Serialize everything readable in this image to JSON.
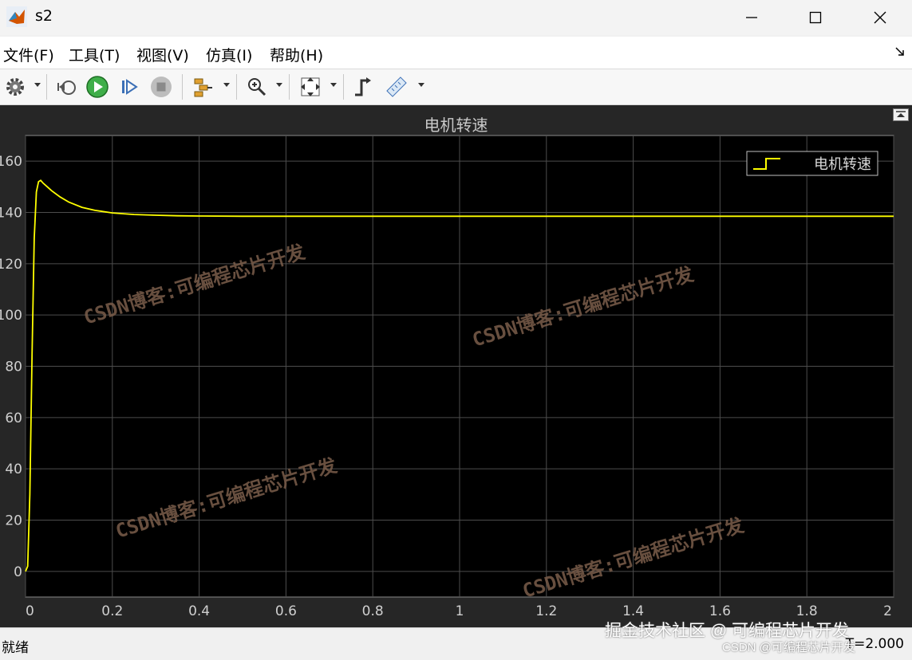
{
  "window": {
    "title": "s2"
  },
  "menu": [
    {
      "label": "文件(F)"
    },
    {
      "label": "工具(T)"
    },
    {
      "label": "视图(V)"
    },
    {
      "label": "仿真(I)"
    },
    {
      "label": "帮助(H)"
    }
  ],
  "toolbar": {
    "icons": [
      "settings-icon",
      "step-back-icon",
      "run-icon",
      "step-forward-icon",
      "stop-icon",
      "signal-selector-icon",
      "zoom-icon",
      "autoscale-icon",
      "triggers-icon",
      "measurements-icon"
    ]
  },
  "colors": {
    "plot_bg": "#000000",
    "frame_bg": "#262626",
    "trace": "#ffff00",
    "grid": "#4d4d4d",
    "axis_text": "#cfcfcf"
  },
  "chart_data": {
    "type": "line",
    "title": "电机转速",
    "xlim": [
      0,
      2
    ],
    "ylim": [
      -10,
      170
    ],
    "x_ticks": [
      0,
      0.2,
      0.4,
      0.6,
      0.8,
      1,
      1.2,
      1.4,
      1.6,
      1.8,
      2
    ],
    "x_tick_labels": [
      "0",
      "0.2",
      "0.4",
      "0.6",
      "0.8",
      "1",
      "1.2",
      "1.4",
      "1.6",
      "1.8",
      "2"
    ],
    "y_ticks": [
      0,
      20,
      40,
      60,
      80,
      100,
      120,
      140,
      160
    ],
    "y_tick_labels": [
      "0",
      "20",
      "40",
      "60",
      "80",
      "100",
      "120",
      "140",
      "160"
    ],
    "grid": true,
    "legend_position": "top-right",
    "series": [
      {
        "name": "电机转速",
        "x": [
          0,
          0.005,
          0.01,
          0.015,
          0.02,
          0.025,
          0.03,
          0.035,
          0.04,
          0.05,
          0.06,
          0.08,
          0.1,
          0.13,
          0.16,
          0.2,
          0.25,
          0.3,
          0.35,
          0.4,
          0.5,
          0.6,
          0.8,
          1.0,
          1.2,
          1.4,
          1.6,
          1.8,
          2.0
        ],
        "y": [
          0,
          2,
          30,
          85,
          130,
          148,
          152,
          152.5,
          151.5,
          150,
          148.5,
          146,
          144,
          142,
          140.8,
          139.8,
          139.2,
          138.9,
          138.7,
          138.6,
          138.5,
          138.5,
          138.5,
          138.5,
          138.5,
          138.5,
          138.5,
          138.5,
          138.5
        ]
      }
    ]
  },
  "watermarks": [
    "CSDN博客:可编程芯片开发",
    "CSDN博客:可编程芯片开发",
    "CSDN博客:可编程芯片开发",
    "CSDN博客:可编程芯片开发"
  ],
  "corner_watermark": "掘金技术社区 @ 可编程芯片开发",
  "csdn_watermark": "CSDN @可编程芯片开发",
  "status": {
    "left": "就绪",
    "right": "T=2.000"
  }
}
